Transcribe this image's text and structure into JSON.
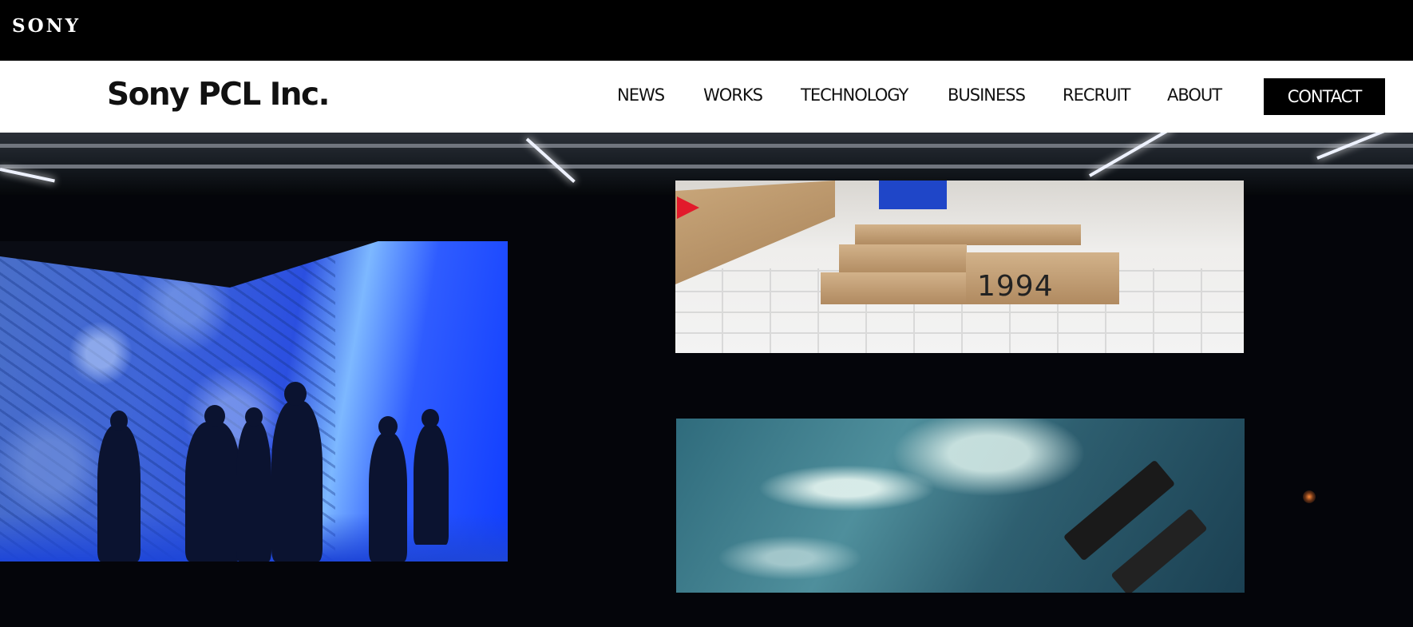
{
  "top_bar": {
    "brand_logo": "SONY"
  },
  "header": {
    "site_title": "Sony PCL Inc.",
    "nav": [
      "NEWS",
      "WORKS",
      "TECHNOLOGY",
      "BUSINESS",
      "RECRUIT",
      "ABOUT"
    ],
    "contact_label": "CONTACT"
  },
  "hero": {
    "year_sign": "1994"
  }
}
